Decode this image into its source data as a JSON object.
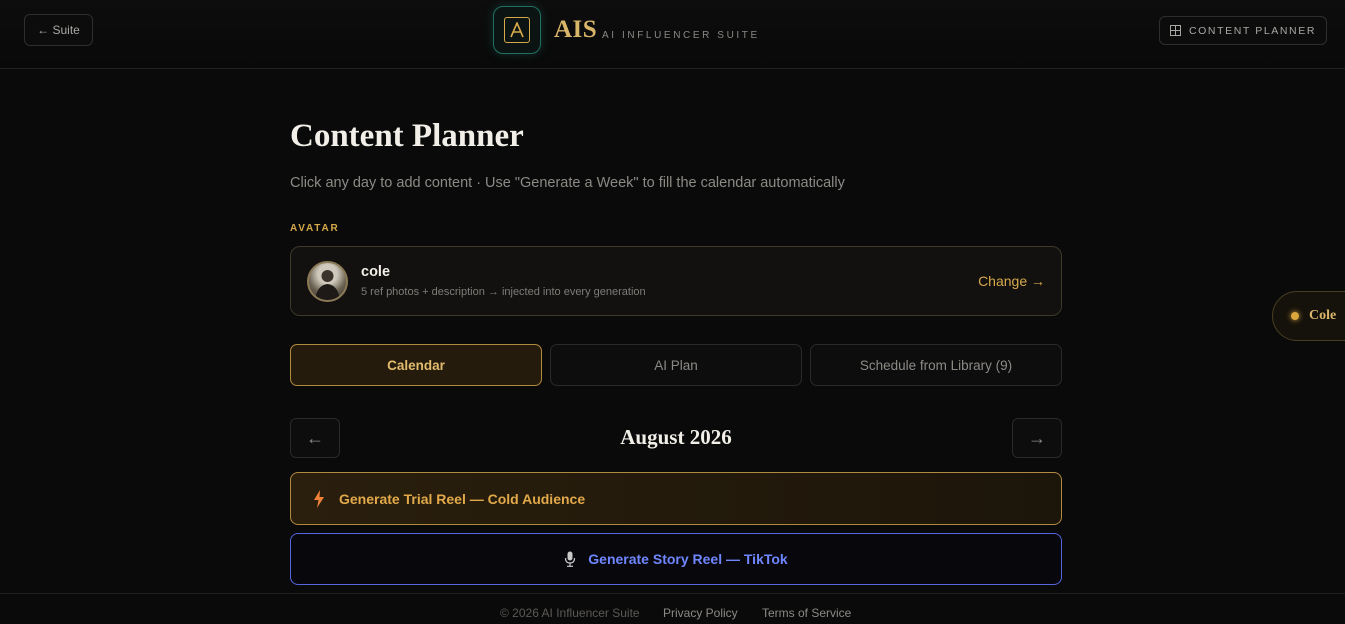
{
  "header": {
    "back_label": "← Suite",
    "brand": "AIS",
    "brand_sub": "AI INFLUENCER SUITE",
    "planner_label": "CONTENT PLANNER"
  },
  "main": {
    "title": "Content Planner",
    "subtitle": "Click any day to add content · Use \"Generate a Week\" to fill the calendar automatically",
    "avatar_section_label": "AVATAR",
    "avatar": {
      "name": "cole",
      "description": "5 ref photos + description → injected into every generation",
      "change_label": "Change →"
    },
    "tabs": [
      {
        "label": "Calendar",
        "active": true
      },
      {
        "label": "AI Plan",
        "active": false
      },
      {
        "label": "Schedule from Library (9)",
        "active": false
      }
    ],
    "month": "August 2026",
    "prev_label": "←",
    "next_label": "→",
    "generate_trial_label": "Generate Trial Reel — Cold Audience",
    "generate_story_label": "Generate Story Reel — TikTok"
  },
  "side_pill": {
    "name": "Cole"
  },
  "footer": {
    "copyright": "© 2026 AI Influencer Suite",
    "privacy": "Privacy Policy",
    "terms": "Terms of Service"
  },
  "colors": {
    "accent_gold": "#d7a94b",
    "accent_blue": "#6f86ff",
    "background": "#0a0a0a"
  }
}
